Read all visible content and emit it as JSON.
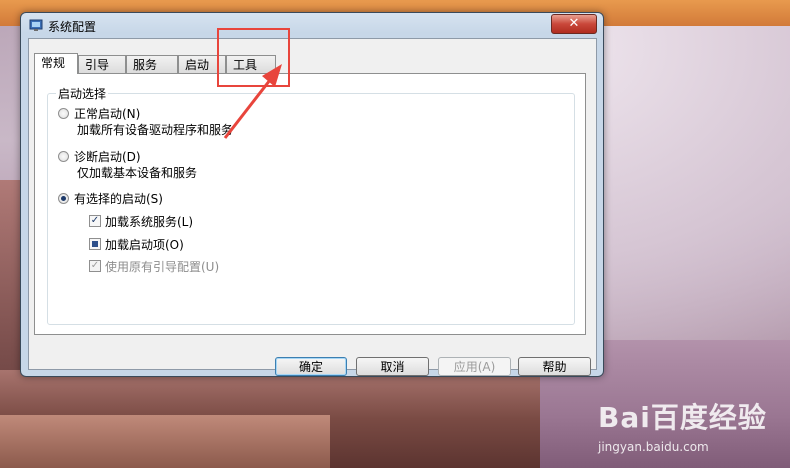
{
  "window": {
    "title": "系统配置",
    "close_label": "✕"
  },
  "tabs": [
    "常规",
    "引导",
    "服务",
    "启动",
    "工具"
  ],
  "groupbox": {
    "title": "启动选择"
  },
  "options": {
    "normal": {
      "label": "正常启动(N)",
      "desc": "加载所有设备驱动程序和服务"
    },
    "diagnostic": {
      "label": "诊断启动(D)",
      "desc": "仅加载基本设备和服务"
    },
    "selective": {
      "label": "有选择的启动(S)"
    }
  },
  "checkboxes": {
    "system_services": {
      "label": "加载系统服务(L)"
    },
    "startup_items": {
      "label": "加载启动项(O)"
    },
    "original_boot": {
      "label": "使用原有引导配置(U)"
    }
  },
  "buttons": {
    "ok": "确定",
    "cancel": "取消",
    "apply": "应用(A)",
    "help": "帮助"
  },
  "watermark": {
    "logo": "Bai百度经验",
    "url": "jingyan.baidu.com"
  },
  "colors": {
    "accent": "#1d3a6a",
    "annotation": "#e8453c"
  }
}
